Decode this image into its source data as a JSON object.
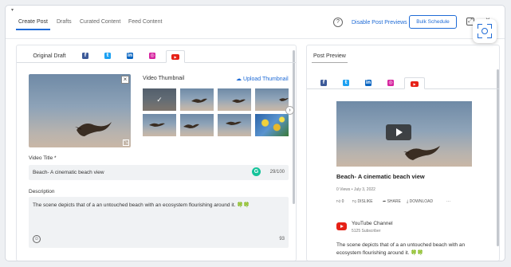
{
  "nav": {
    "tabs": [
      "Create Post",
      "Drafts",
      "Curated Content",
      "Feed Content"
    ],
    "active_tab": "Create Post",
    "help_label": "?",
    "disable_previews": "Disable Post Previews",
    "bulk_schedule": "Bulk Schedule"
  },
  "editor": {
    "tabs": [
      {
        "label": "Original Draft",
        "icon": "draft"
      },
      {
        "icon": "facebook-icon",
        "glyph": "f"
      },
      {
        "icon": "twitter-icon",
        "glyph": "t"
      },
      {
        "icon": "linkedin-icon",
        "glyph": "in"
      },
      {
        "icon": "instagram-icon",
        "glyph": "◎"
      },
      {
        "icon": "youtube-icon",
        "glyph": "▶"
      }
    ],
    "active_tab": "youtube",
    "video_thumbnail_label": "Video Thumbnail",
    "upload_thumbnail": "Upload Thumbnail",
    "thumbnail_count": 8,
    "selected_thumbnail": 1,
    "video_title_label": "Video Title *",
    "video_title_value": "Beach- A cinematic beach view",
    "title_counter": "29/100",
    "description_label": "Description",
    "description_value": "The scene depicts that of a an untouched beach with an ecosystem flourishing around it. 🍀🍀",
    "description_counter": "93"
  },
  "preview": {
    "title": "Post Preview",
    "video_title": "Beach- A cinematic beach view",
    "meta": "0 Views  •  July 3, 2022",
    "likes": "0",
    "dislike": "DISLIKE",
    "share": "SHARE",
    "download": "DOWNLOAD",
    "more": "···",
    "channel_name": "YouTube Channel",
    "channel_subs": "5125 Subscriber",
    "description": "The scene depicts that of a an untouched beach with an ecosystem flourishing around it. 🍀🍀"
  },
  "colors": {
    "accent": "#1f6bd6",
    "youtube_red": "#e62117",
    "facebook": "#3b5998",
    "twitter": "#1da1f2",
    "linkedin": "#0a66c2",
    "instagram": "#d6249f",
    "grammarly": "#15c39a"
  }
}
